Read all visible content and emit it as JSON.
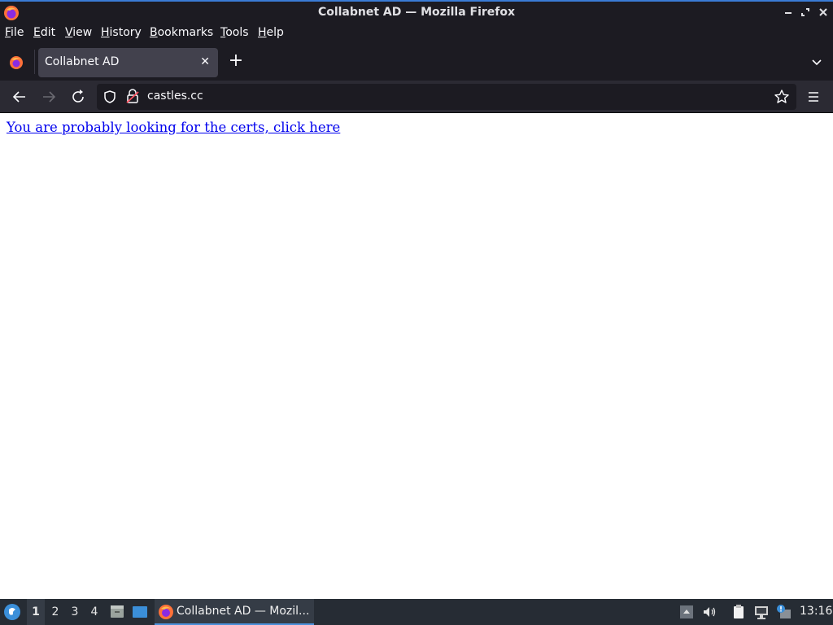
{
  "window": {
    "title": "Collabnet AD — Mozilla Firefox",
    "controls": [
      "minimize",
      "maximize",
      "close"
    ]
  },
  "menubar": {
    "items": [
      {
        "label": "File",
        "accel": "F",
        "rest": "ile"
      },
      {
        "label": "Edit",
        "accel": "E",
        "rest": "dit"
      },
      {
        "label": "View",
        "accel": "V",
        "rest": "iew"
      },
      {
        "label": "History",
        "accel": "H",
        "rest": "istory"
      },
      {
        "label": "Bookmarks",
        "accel": "B",
        "rest": "ookmarks"
      },
      {
        "label": "Tools",
        "accel": "T",
        "rest": "ools"
      },
      {
        "label": "Help",
        "accel": "H",
        "rest": "elp"
      }
    ]
  },
  "tabs": [
    {
      "label": "Collabnet AD",
      "active": true
    }
  ],
  "navbar": {
    "url": "castles.cc"
  },
  "page": {
    "link_text": "You are probably looking for the certs, click here"
  },
  "taskbar": {
    "workspaces": [
      "1",
      "2",
      "3",
      "4"
    ],
    "active_workspace": "1",
    "task_label": "Collabnet AD — Mozil...",
    "clock": "13:16"
  },
  "colors": {
    "titlebar_bg": "#1c1b22",
    "navbar_bg": "#2b2a33",
    "tab_active_bg": "#42414d",
    "link": "#0000ee",
    "taskbar_bg": "#262c34",
    "accent": "#3a7bd5"
  }
}
